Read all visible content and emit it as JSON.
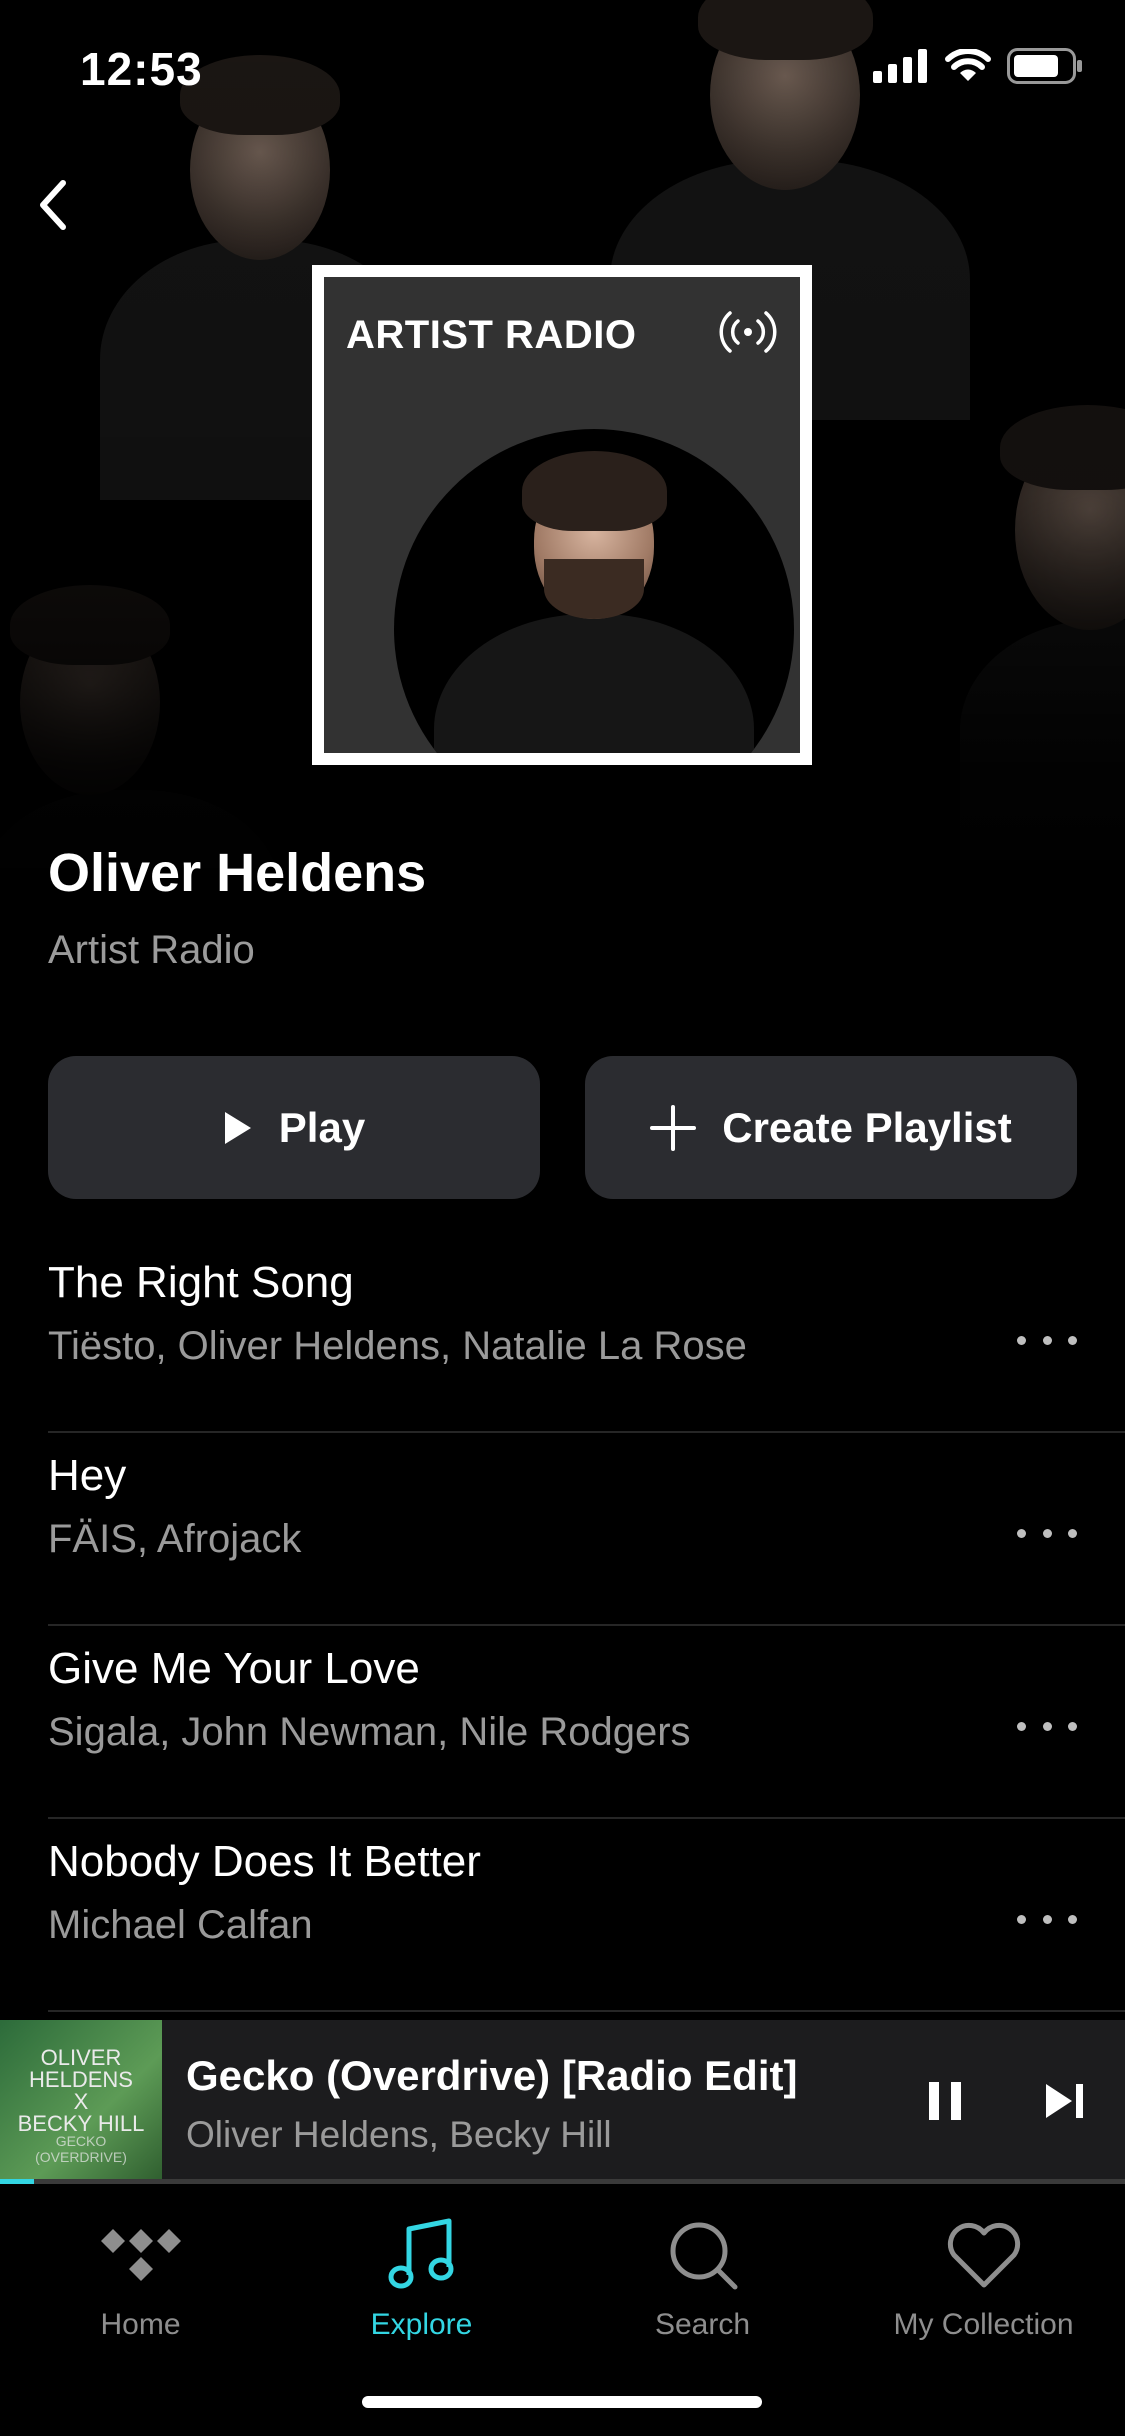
{
  "status_bar": {
    "time": "12:53"
  },
  "artwork": {
    "title": "ARTIST RADIO"
  },
  "artist": {
    "name": "Oliver Heldens",
    "subtitle": "Artist Radio"
  },
  "actions": {
    "play_label": "Play",
    "create_playlist_label": "Create Playlist"
  },
  "tracks": [
    {
      "title": "The Right Song",
      "artists": "Tiësto, Oliver Heldens, Natalie La Rose"
    },
    {
      "title": "Hey",
      "artists": "FÄIS, Afrojack"
    },
    {
      "title": "Give Me Your Love",
      "artists": "Sigala, John Newman, Nile Rodgers"
    },
    {
      "title": "Nobody Does It Better",
      "artists": "Michael Calfan"
    }
  ],
  "now_playing": {
    "title": "Gecko (Overdrive) [Radio Edit]",
    "artists": "Oliver Heldens, Becky Hill",
    "art_text": [
      "OLIVER",
      "HELDENS",
      "X",
      "BECKY HILL",
      "GECKO",
      "(OVERDRIVE)"
    ],
    "progress": 0.03
  },
  "tabs": [
    {
      "label": "Home",
      "icon": "tidal-logo-icon"
    },
    {
      "label": "Explore",
      "icon": "music-note-icon",
      "active": true
    },
    {
      "label": "Search",
      "icon": "search-icon"
    },
    {
      "label": "My Collection",
      "icon": "heart-icon"
    }
  ],
  "colors": {
    "accent": "#33d6e3",
    "button_bg": "#2b2c30",
    "secondary_text": "#9a9a9a"
  }
}
